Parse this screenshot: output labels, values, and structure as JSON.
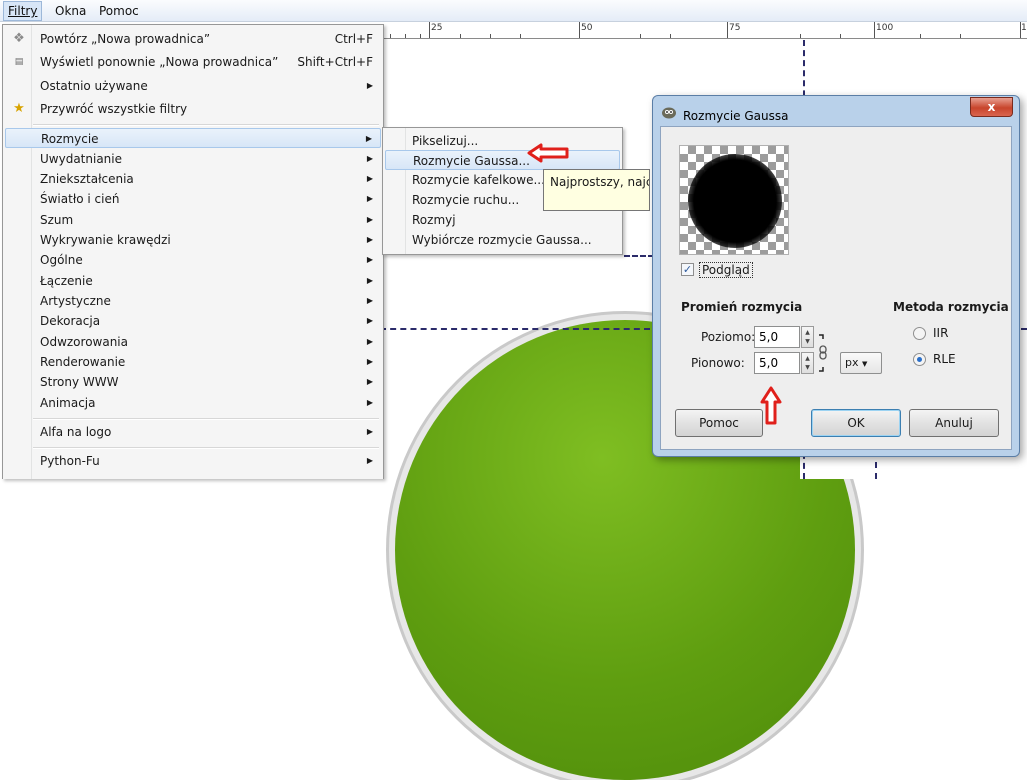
{
  "menubar": {
    "filters": "Filtry",
    "windows": "Okna",
    "help": "Pomoc"
  },
  "ruler": {
    "labels": [
      "25",
      "50",
      "75",
      "100",
      "1"
    ]
  },
  "filters_menu": {
    "items": [
      {
        "label": "Powtórz „Nowa prowadnica”",
        "shortcut": "Ctrl+F",
        "icon": "repeat-icon"
      },
      {
        "label": "Wyświetl ponownie „Nowa prowadnica”",
        "shortcut": "Shift+Ctrl+F",
        "icon": "reshow-icon"
      },
      {
        "label": "Ostatnio używane",
        "submenu": true
      },
      {
        "label": "Przywróć wszystkie filtry",
        "icon": "reset-filters-icon"
      },
      {
        "label": "Rozmycie",
        "submenu": true,
        "highlighted": true
      },
      {
        "label": "Uwydatnianie",
        "submenu": true
      },
      {
        "label": "Zniekształcenia",
        "submenu": true
      },
      {
        "label": "Światło i cień",
        "submenu": true
      },
      {
        "label": "Szum",
        "submenu": true
      },
      {
        "label": "Wykrywanie krawędzi",
        "submenu": true
      },
      {
        "label": "Ogólne",
        "submenu": true
      },
      {
        "label": "Łączenie",
        "submenu": true
      },
      {
        "label": "Artystyczne",
        "submenu": true
      },
      {
        "label": "Dekoracja",
        "submenu": true
      },
      {
        "label": "Odwzorowania",
        "submenu": true
      },
      {
        "label": "Renderowanie",
        "submenu": true
      },
      {
        "label": "Strony WWW",
        "submenu": true
      },
      {
        "label": "Animacja",
        "submenu": true
      },
      {
        "label": "Alfa na logo",
        "submenu": true
      },
      {
        "label": "Python-Fu",
        "submenu": true
      }
    ]
  },
  "blur_submenu": {
    "items": [
      {
        "label": "Pikselizuj..."
      },
      {
        "label": "Rozmycie Gaussa...",
        "highlighted": true
      },
      {
        "label": "Rozmycie kafelkowe..."
      },
      {
        "label": "Rozmycie ruchu..."
      },
      {
        "label": "Rozmyj"
      },
      {
        "label": "Wybiórcze rozmycie Gaussa..."
      }
    ]
  },
  "tooltip": {
    "text": "Najprostszy, najczę"
  },
  "dialog": {
    "title": "Rozmycie Gaussa",
    "close": "x",
    "preview_label": "Podgląd",
    "preview_checked": true,
    "radius_title": "Promień rozmycia",
    "horizontal_label": "Poziomo:",
    "horizontal_value": "5,0",
    "vertical_label": "Pionowo:",
    "vertical_value": "5,0",
    "unit": "px",
    "method_title": "Metoda rozmycia",
    "methods": [
      {
        "label": "IIR",
        "selected": false
      },
      {
        "label": "RLE",
        "selected": true
      }
    ],
    "help_button": "Pomoc",
    "ok_button": "OK",
    "cancel_button": "Anuluj"
  },
  "colors": {
    "arrow": "#e0201b",
    "green": "#5f9e10",
    "highlight": "#d7e6f7"
  }
}
